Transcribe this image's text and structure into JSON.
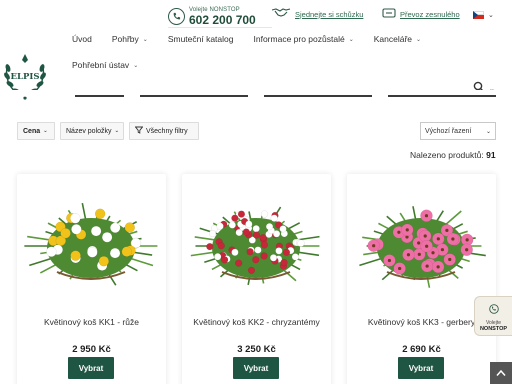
{
  "header": {
    "logo_text": "ELPIS",
    "phone_label": "Volejte NONSTOP",
    "phone_number": "602 200 700",
    "meeting_link": "Sjednejte si schůzku",
    "transfer_link": "Převoz zesnulého",
    "language": "cs"
  },
  "nav": {
    "items": [
      {
        "label": "Úvod",
        "has_menu": false
      },
      {
        "label": "Pohřby",
        "has_menu": true
      },
      {
        "label": "Smuteční katalog",
        "has_menu": false
      },
      {
        "label": "Informace pro pozůstalé",
        "has_menu": true
      },
      {
        "label": "Kanceláře",
        "has_menu": true
      }
    ],
    "items2": [
      {
        "label": "Pohřební ústav",
        "has_menu": true
      }
    ],
    "chevron": "⌄"
  },
  "filters": {
    "price": "Cena",
    "name": "Název položky",
    "all": "Všechny filtry",
    "sort": "Výchozí řazení"
  },
  "results": {
    "label": "Nalezeno produktů:",
    "count": "91"
  },
  "products": [
    {
      "name": "Květinový koš KK1 - růže",
      "price": "2 950 Kč",
      "button": "Vybrat",
      "flower_color": "#f0c21a",
      "accent_color": "#ffffff"
    },
    {
      "name": "Květinový koš KK2 - chryzantémy",
      "price": "3 250 Kč",
      "button": "Vybrat",
      "flower_color": "#c6283a",
      "accent_color": "#ffffff"
    },
    {
      "name": "Květinový koš KK3 - gerbery",
      "price": "2 690 Kč",
      "button": "Vybrat",
      "flower_color": "#ee6fa6",
      "accent_color": "#f7b4d1"
    }
  ],
  "nonstop_widget": {
    "line1": "Volejte",
    "line2": "NONSTOP"
  },
  "colors": {
    "brand_green": "#1f5643",
    "accent_green": "#2f6a50"
  }
}
